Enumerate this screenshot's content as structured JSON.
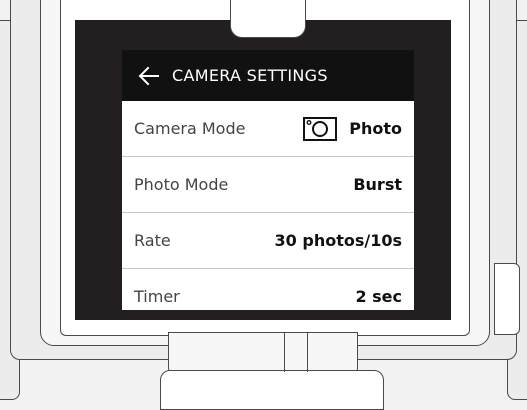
{
  "header": {
    "title": "CAMERA SETTINGS"
  },
  "settings": [
    {
      "label": "Camera Mode",
      "value": "Photo",
      "icon": "camera-icon"
    },
    {
      "label": "Photo Mode",
      "value": "Burst"
    },
    {
      "label": "Rate",
      "value": "30 photos/10s"
    },
    {
      "label": "Timer",
      "value": "2 sec"
    }
  ]
}
